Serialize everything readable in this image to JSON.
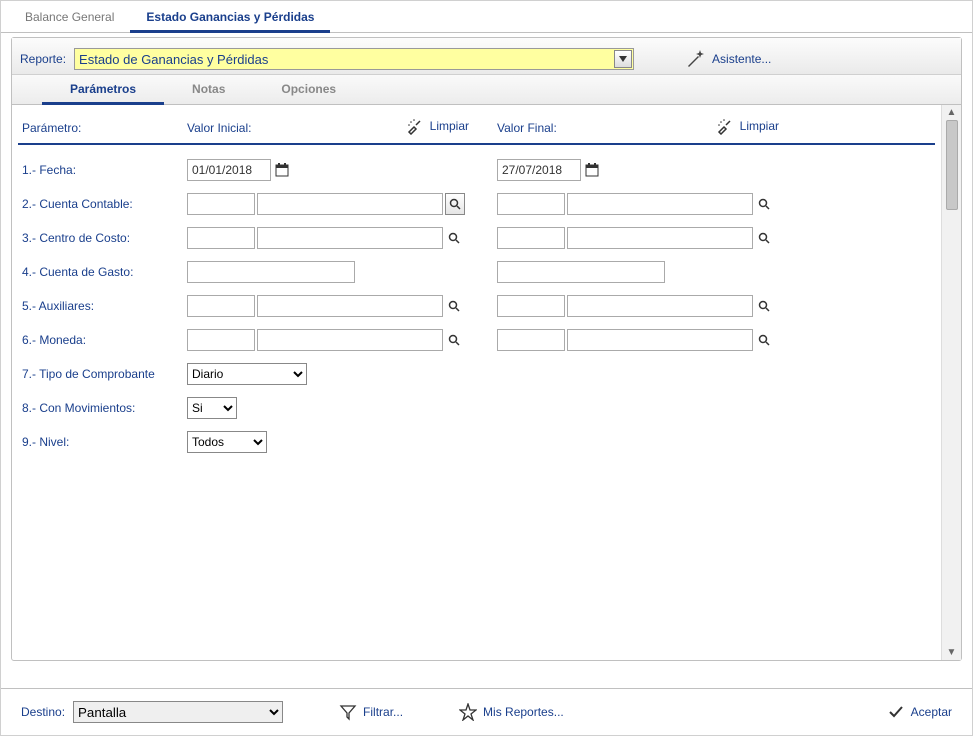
{
  "topTabs": {
    "t1": "Balance General",
    "t2": "Estado Ganancias y Pérdidas"
  },
  "reporte": {
    "label": "Reporte:",
    "value": "Estado de Ganancias y Pérdidas",
    "asistente": "Asistente..."
  },
  "innerTabs": {
    "parametros": "Parámetros",
    "notas": "Notas",
    "opciones": "Opciones"
  },
  "headers": {
    "parametro": "Parámetro:",
    "valorInicial": "Valor Inicial:",
    "valorFinal": "Valor Final:",
    "limpiar": "Limpiar"
  },
  "rows": {
    "r1": {
      "label": "1.- Fecha:",
      "inicial": "01/01/2018",
      "final": "27/07/2018"
    },
    "r2": {
      "label": "2.- Cuenta Contable:"
    },
    "r3": {
      "label": "3.- Centro de Costo:"
    },
    "r4": {
      "label": "4.- Cuenta de Gasto:"
    },
    "r5": {
      "label": "5.- Auxiliares:"
    },
    "r6": {
      "label": "6.- Moneda:"
    },
    "r7": {
      "label": "7.- Tipo de Comprobante",
      "value": "Diario"
    },
    "r8": {
      "label": "8.- Con Movimientos:",
      "value": "Si"
    },
    "r9": {
      "label": "9.- Nivel:",
      "value": "Todos"
    }
  },
  "bottom": {
    "destino": "Destino:",
    "destinoValue": "Pantalla",
    "filtrar": "Filtrar...",
    "misReportes": "Mis Reportes...",
    "aceptar": "Aceptar"
  }
}
